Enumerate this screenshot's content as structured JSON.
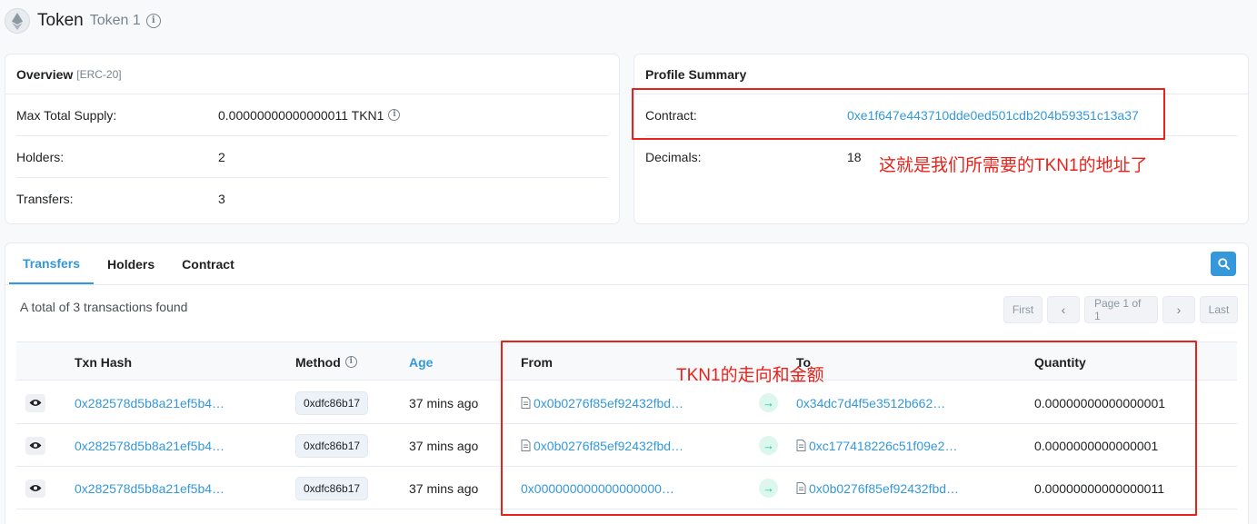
{
  "header": {
    "title": "Token",
    "subtitle": "Token 1"
  },
  "overview": {
    "title": "Overview",
    "standard": "[ERC-20]",
    "rows": [
      {
        "label": "Max Total Supply:",
        "value": "0.00000000000000011 TKN1"
      },
      {
        "label": "Holders:",
        "value": "2"
      },
      {
        "label": "Transfers:",
        "value": "3"
      }
    ]
  },
  "profile": {
    "title": "Profile Summary",
    "contract_label": "Contract:",
    "contract_value": "0xe1f647e443710dde0ed501cdb204b59351c13a37",
    "decimals_label": "Decimals:",
    "decimals_value": "18"
  },
  "annotations": {
    "contract_note": "这就是我们所需要的TKN1的地址了",
    "transfer_note": "TKN1的走向和金额"
  },
  "tabs": [
    "Transfers",
    "Holders",
    "Contract"
  ],
  "transfers": {
    "summary": "A total of 3 transactions found",
    "pager": {
      "first": "First",
      "page": "Page 1 of 1",
      "last": "Last",
      "prev": "‹",
      "next": "›"
    },
    "columns": {
      "txn_hash": "Txn Hash",
      "method": "Method",
      "age": "Age",
      "from": "From",
      "to": "To",
      "quantity": "Quantity"
    },
    "rows": [
      {
        "hash": "0x282578d5b8a21ef5b4…",
        "method": "0xdfc86b17",
        "age": "37 mins ago",
        "from": "0x0b0276f85ef92432fbd…",
        "to": "0x34dc7d4f5e3512b662…",
        "quantity": "0.00000000000000001"
      },
      {
        "hash": "0x282578d5b8a21ef5b4…",
        "method": "0xdfc86b17",
        "age": "37 mins ago",
        "from": "0x0b0276f85ef92432fbd…",
        "to": "0xc177418226c51f09e2…",
        "quantity": "0.0000000000000001"
      },
      {
        "hash": "0x282578d5b8a21ef5b4…",
        "method": "0xdfc86b17",
        "age": "37 mins ago",
        "from": "0x000000000000000000…",
        "to": "0x0b0276f85ef92432fbd…",
        "quantity": "0.00000000000000011"
      }
    ]
  },
  "colors": {
    "link": "#3498db",
    "annotation_red": "#e8221b",
    "arrow_green": "#00c9a7"
  }
}
